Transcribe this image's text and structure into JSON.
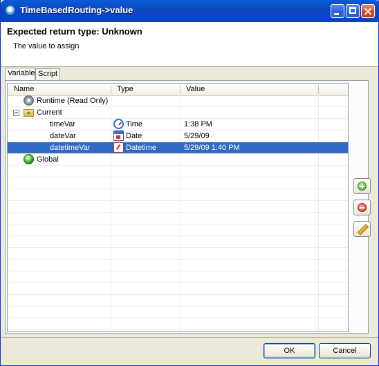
{
  "window": {
    "title": "TimeBasedRouting->value",
    "icon": "app-icon",
    "controls": [
      "minimize-button",
      "maximize-button",
      "close-button"
    ]
  },
  "header": {
    "title": "Expected return type: Unknown",
    "description": "The value to assign"
  },
  "tabs": [
    {
      "label": "Variable",
      "active": true
    },
    {
      "label": "Script",
      "active": false
    }
  ],
  "table": {
    "columns": [
      "Name",
      "Type",
      "Value"
    ],
    "rows": [
      {
        "name": "Runtime (Read Only)",
        "type": "",
        "value": "",
        "icon": "gear-icon",
        "level": 1,
        "selected": false
      },
      {
        "name": "Current",
        "type": "",
        "value": "",
        "icon": "folder-icon",
        "level": 1,
        "expanded": true,
        "selected": false
      },
      {
        "name": "timeVar",
        "type": "Time",
        "type_icon": "clock-icon",
        "value": "1:38 PM",
        "level": 2,
        "selected": false
      },
      {
        "name": "dateVar",
        "type": "Date",
        "type_icon": "calendar-icon",
        "value": "5/29/09",
        "level": 2,
        "selected": false
      },
      {
        "name": "datetimeVar",
        "type": "Datetime",
        "type_icon": "datetime-icon",
        "value": "5/29/09 1:40 PM",
        "level": 2,
        "selected": true
      },
      {
        "name": "Global",
        "type": "",
        "value": "",
        "icon": "globe-icon",
        "level": 1,
        "selected": false
      }
    ]
  },
  "side_buttons": [
    "add-icon",
    "remove-icon",
    "edit-icon"
  ],
  "buttons": {
    "ok": "OK",
    "cancel": "Cancel"
  },
  "colors": {
    "title_bar": "#0a4fd0",
    "selection": "#316ac5",
    "dialog_bg": "#ece9d8"
  }
}
